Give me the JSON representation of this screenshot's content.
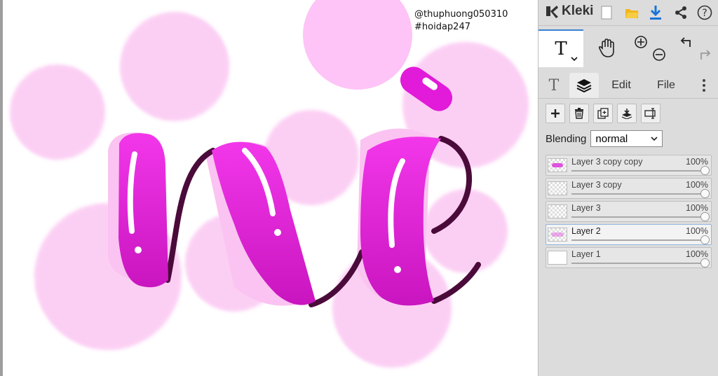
{
  "canvas": {
    "watermark_line1": "@thuphuong050310",
    "watermark_line2": "#hoidap247"
  },
  "app": {
    "brand": "Kleki",
    "brand_icon": "kleki-logo-icon"
  },
  "toolbar": {
    "new_icon": "new-file-icon",
    "open_icon": "open-folder-icon",
    "save_icon": "download-icon",
    "share_icon": "share-icon",
    "help_icon": "help-icon"
  },
  "tools": {
    "text_tool": "T",
    "hand_tool_icon": "hand-icon",
    "zoom_in_icon": "zoom-in-icon",
    "zoom_out_icon": "zoom-out-icon",
    "undo_icon": "undo-icon",
    "redo_icon": "redo-icon"
  },
  "tabs": {
    "text_tab": "T",
    "layers_tab_icon": "layers-icon",
    "edit": "Edit",
    "file": "File",
    "more_icon": "more-vertical-icon"
  },
  "layer_actions": [
    "add-layer-icon",
    "delete-layer-icon",
    "duplicate-layer-icon",
    "merge-down-icon",
    "rename-layer-icon"
  ],
  "blending": {
    "label": "Blending",
    "value": "normal"
  },
  "layers": [
    {
      "name": "Layer 3 copy copy",
      "opacity": "100%",
      "opacity_value": 1.0,
      "active": false
    },
    {
      "name": "Layer 3 copy",
      "opacity": "100%",
      "opacity_value": 1.0,
      "active": false
    },
    {
      "name": "Layer 3",
      "opacity": "100%",
      "opacity_value": 1.0,
      "active": false
    },
    {
      "name": "Layer 2",
      "opacity": "100%",
      "opacity_value": 1.0,
      "active": true
    },
    {
      "name": "Layer 1",
      "opacity": "100%",
      "opacity_value": 1.0,
      "active": false
    }
  ],
  "colors": {
    "magenta": "#e21ad9",
    "light_pink": "#ffc3f6",
    "dark_purple": "#4a0b3a",
    "accent_blue": "#3a82d6"
  }
}
